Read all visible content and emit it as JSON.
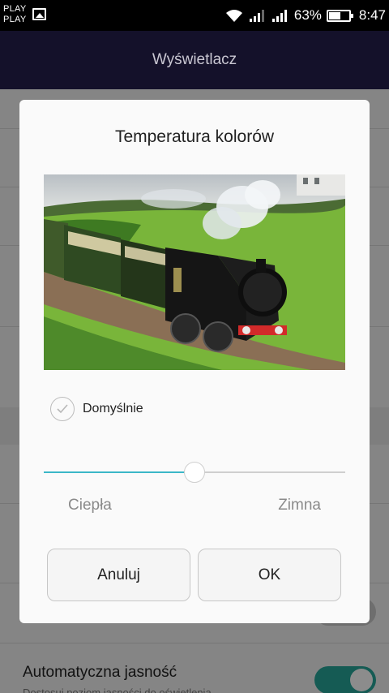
{
  "status_bar": {
    "notification_text": "PLAY\nPLAY",
    "battery_percent": "63%",
    "battery_level": 0.63,
    "time": "8:47",
    "icons": [
      "image-icon",
      "wifi-icon",
      "signal-icon",
      "signal-icon",
      "battery-icon"
    ]
  },
  "app_bar": {
    "title": "Wyświetlacz"
  },
  "background_settings": {
    "auto_brightness": {
      "label": "Automatyczna jasność",
      "subtitle": "Dostosuj poziom jasności do oświetlenia",
      "enabled": true
    },
    "previous_toggle_enabled": false
  },
  "dialog": {
    "title": "Temperatura kolorów",
    "preview_image": "steam-locomotive-photo",
    "default_option": {
      "label": "Domyślnie",
      "checked": false
    },
    "slider": {
      "min_label": "Ciepła",
      "max_label": "Zimna",
      "value": 0.5
    },
    "buttons": {
      "cancel": "Anuluj",
      "ok": "OK"
    }
  },
  "colors": {
    "app_bar": "#14112a",
    "slider_accent": "#3bb7c7",
    "toggle_on": "#27a69a",
    "locomotive_red": "#d22a2a"
  }
}
